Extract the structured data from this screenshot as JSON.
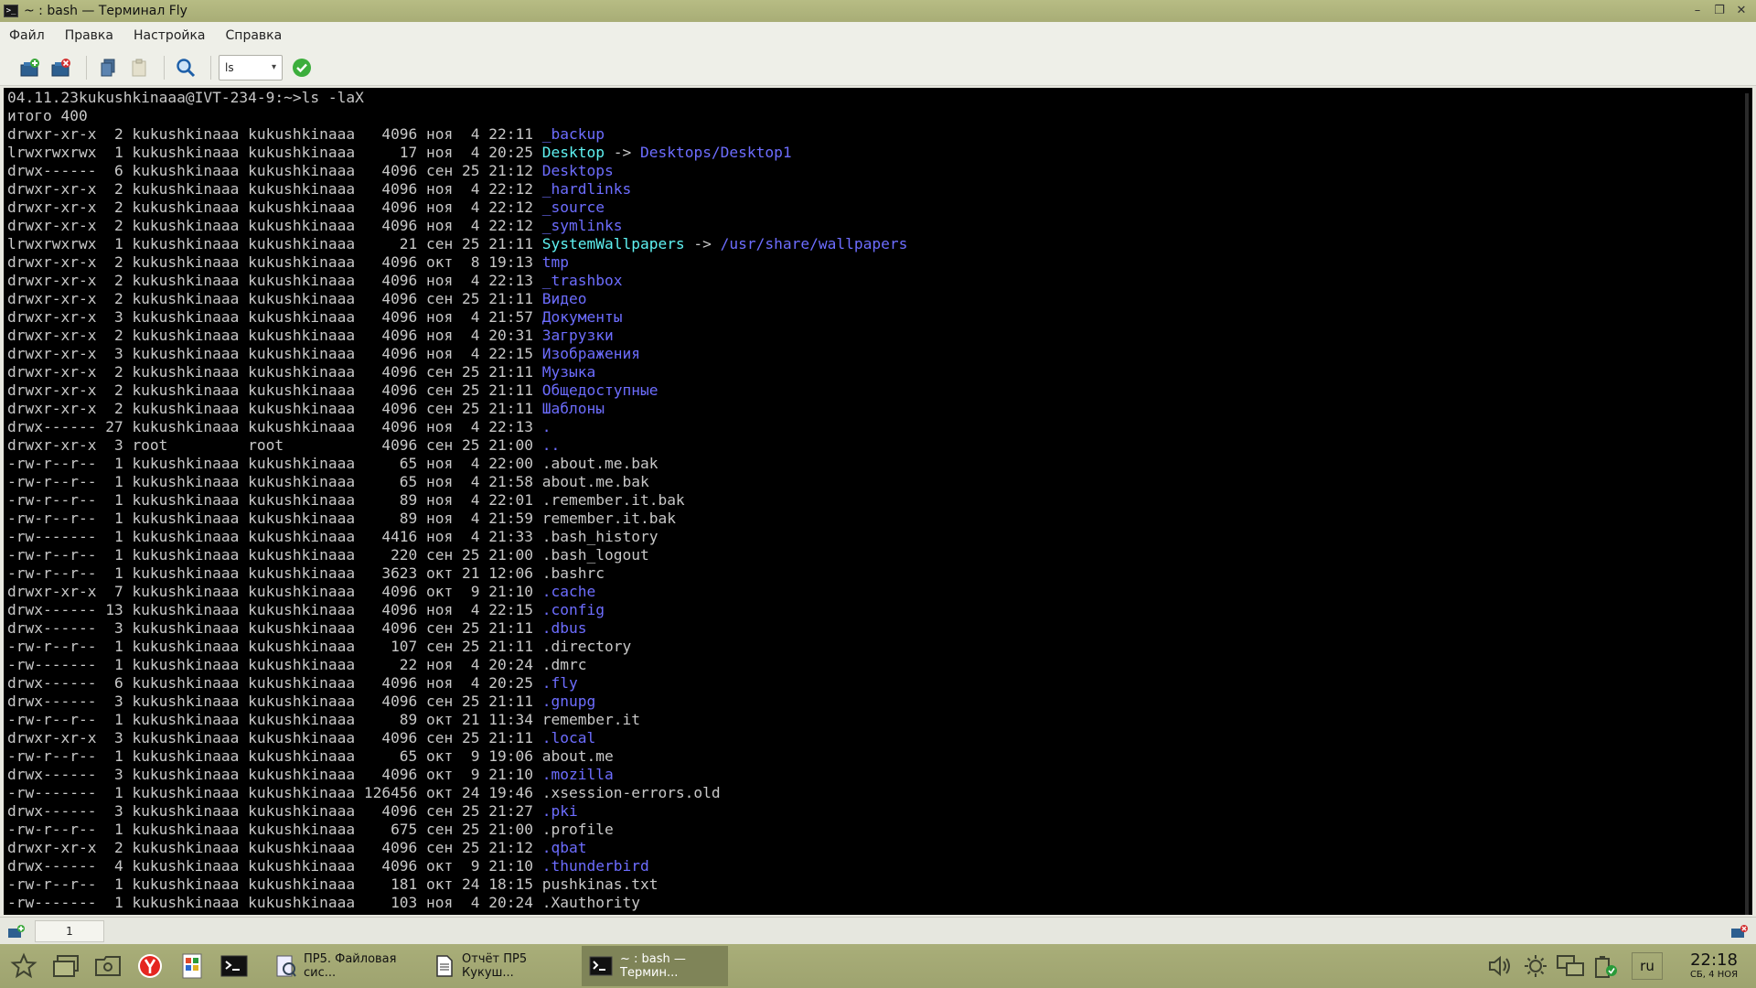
{
  "window": {
    "title": "~ : bash — Терминал Fly",
    "icon": "terminal-icon",
    "controls": [
      "minimize-icon",
      "restore-icon",
      "close-icon"
    ]
  },
  "menu": [
    "Файл",
    "Правка",
    "Настройка",
    "Справка"
  ],
  "toolbar": {
    "command_combo_value": "ls",
    "buttons": [
      "new-terminal-icon",
      "close-terminal-icon",
      "copy-icon",
      "paste-icon",
      "search-icon",
      "execute-icon"
    ]
  },
  "terminal": {
    "prompt": "04.11.23kukushkinaaa@IVT-234-9:~>",
    "command": "ls -laX",
    "total": "итого 400",
    "entries": [
      {
        "meta": "drwxr-xr-x  2 kukushkinaaa kukushkinaaa   4096 ноя  4 22:11 ",
        "name": "_backup",
        "type": "dir"
      },
      {
        "meta": "lrwxrwxrwx  1 kukushkinaaa kukushkinaaa     17 ноя  4 20:25 ",
        "name": "Desktop",
        "type": "link",
        "target": "Desktops/Desktop1"
      },
      {
        "meta": "drwx------  6 kukushkinaaa kukushkinaaa   4096 сен 25 21:12 ",
        "name": "Desktops",
        "type": "dir"
      },
      {
        "meta": "drwxr-xr-x  2 kukushkinaaa kukushkinaaa   4096 ноя  4 22:12 ",
        "name": "_hardlinks",
        "type": "dir"
      },
      {
        "meta": "drwxr-xr-x  2 kukushkinaaa kukushkinaaa   4096 ноя  4 22:12 ",
        "name": "_source",
        "type": "dir"
      },
      {
        "meta": "drwxr-xr-x  2 kukushkinaaa kukushkinaaa   4096 ноя  4 22:12 ",
        "name": "_symlinks",
        "type": "dir"
      },
      {
        "meta": "lrwxrwxrwx  1 kukushkinaaa kukushkinaaa     21 сен 25 21:11 ",
        "name": "SystemWallpapers",
        "type": "link",
        "target": "/usr/share/wallpapers"
      },
      {
        "meta": "drwxr-xr-x  2 kukushkinaaa kukushkinaaa   4096 окт  8 19:13 ",
        "name": "tmp",
        "type": "dir"
      },
      {
        "meta": "drwxr-xr-x  2 kukushkinaaa kukushkinaaa   4096 ноя  4 22:13 ",
        "name": "_trashbox",
        "type": "dir"
      },
      {
        "meta": "drwxr-xr-x  2 kukushkinaaa kukushkinaaa   4096 сен 25 21:11 ",
        "name": "Видео",
        "type": "dir"
      },
      {
        "meta": "drwxr-xr-x  3 kukushkinaaa kukushkinaaa   4096 ноя  4 21:57 ",
        "name": "Документы",
        "type": "dir"
      },
      {
        "meta": "drwxr-xr-x  2 kukushkinaaa kukushkinaaa   4096 ноя  4 20:31 ",
        "name": "Загрузки",
        "type": "dir"
      },
      {
        "meta": "drwxr-xr-x  3 kukushkinaaa kukushkinaaa   4096 ноя  4 22:15 ",
        "name": "Изображения",
        "type": "dir"
      },
      {
        "meta": "drwxr-xr-x  2 kukushkinaaa kukushkinaaa   4096 сен 25 21:11 ",
        "name": "Музыка",
        "type": "dir"
      },
      {
        "meta": "drwxr-xr-x  2 kukushkinaaa kukushkinaaa   4096 сен 25 21:11 ",
        "name": "Общедоступные",
        "type": "dir"
      },
      {
        "meta": "drwxr-xr-x  2 kukushkinaaa kukushkinaaa   4096 сен 25 21:11 ",
        "name": "Шаблоны",
        "type": "dir"
      },
      {
        "meta": "drwx------ 27 kukushkinaaa kukushkinaaa   4096 ноя  4 22:13 ",
        "name": ".",
        "type": "dir"
      },
      {
        "meta": "drwxr-xr-x  3 root         root           4096 сен 25 21:00 ",
        "name": "..",
        "type": "dir"
      },
      {
        "meta": "-rw-r--r--  1 kukushkinaaa kukushkinaaa     65 ноя  4 22:00 ",
        "name": ".about.me.bak",
        "type": "file"
      },
      {
        "meta": "-rw-r--r--  1 kukushkinaaa kukushkinaaa     65 ноя  4 21:58 ",
        "name": "about.me.bak",
        "type": "file"
      },
      {
        "meta": "-rw-r--r--  1 kukushkinaaa kukushkinaaa     89 ноя  4 22:01 ",
        "name": ".remember.it.bak",
        "type": "file"
      },
      {
        "meta": "-rw-r--r--  1 kukushkinaaa kukushkinaaa     89 ноя  4 21:59 ",
        "name": "remember.it.bak",
        "type": "file"
      },
      {
        "meta": "-rw-------  1 kukushkinaaa kukushkinaaa   4416 ноя  4 21:33 ",
        "name": ".bash_history",
        "type": "file"
      },
      {
        "meta": "-rw-r--r--  1 kukushkinaaa kukushkinaaa    220 сен 25 21:00 ",
        "name": ".bash_logout",
        "type": "file"
      },
      {
        "meta": "-rw-r--r--  1 kukushkinaaa kukushkinaaa   3623 окт 21 12:06 ",
        "name": ".bashrc",
        "type": "file"
      },
      {
        "meta": "drwxr-xr-x  7 kukushkinaaa kukushkinaaa   4096 окт  9 21:10 ",
        "name": ".cache",
        "type": "dir"
      },
      {
        "meta": "drwx------ 13 kukushkinaaa kukushkinaaa   4096 ноя  4 22:15 ",
        "name": ".config",
        "type": "dir"
      },
      {
        "meta": "drwx------  3 kukushkinaaa kukushkinaaa   4096 сен 25 21:11 ",
        "name": ".dbus",
        "type": "dir"
      },
      {
        "meta": "-rw-r--r--  1 kukushkinaaa kukushkinaaa    107 сен 25 21:11 ",
        "name": ".directory",
        "type": "file"
      },
      {
        "meta": "-rw-------  1 kukushkinaaa kukushkinaaa     22 ноя  4 20:24 ",
        "name": ".dmrc",
        "type": "file"
      },
      {
        "meta": "drwx------  6 kukushkinaaa kukushkinaaa   4096 ноя  4 20:25 ",
        "name": ".fly",
        "type": "dir"
      },
      {
        "meta": "drwx------  3 kukushkinaaa kukushkinaaa   4096 сен 25 21:11 ",
        "name": ".gnupg",
        "type": "dir"
      },
      {
        "meta": "-rw-r--r--  1 kukushkinaaa kukushkinaaa     89 окт 21 11:34 ",
        "name": "remember.it",
        "type": "file"
      },
      {
        "meta": "drwxr-xr-x  3 kukushkinaaa kukushkinaaa   4096 сен 25 21:11 ",
        "name": ".local",
        "type": "dir"
      },
      {
        "meta": "-rw-r--r--  1 kukushkinaaa kukushkinaaa     65 окт  9 19:06 ",
        "name": "about.me",
        "type": "file"
      },
      {
        "meta": "drwx------  3 kukushkinaaa kukushkinaaa   4096 окт  9 21:10 ",
        "name": ".mozilla",
        "type": "dir"
      },
      {
        "meta": "-rw-------  1 kukushkinaaa kukushkinaaa 126456 окт 24 19:46 ",
        "name": ".xsession-errors.old",
        "type": "file"
      },
      {
        "meta": "drwx------  3 kukushkinaaa kukushkinaaa   4096 сен 25 21:27 ",
        "name": ".pki",
        "type": "dir"
      },
      {
        "meta": "-rw-r--r--  1 kukushkinaaa kukushkinaaa    675 сен 25 21:00 ",
        "name": ".profile",
        "type": "file"
      },
      {
        "meta": "drwxr-xr-x  2 kukushkinaaa kukushkinaaa   4096 сен 25 21:12 ",
        "name": ".qbat",
        "type": "dir"
      },
      {
        "meta": "drwx------  4 kukushkinaaa kukushkinaaa   4096 окт  9 21:10 ",
        "name": ".thunderbird",
        "type": "dir"
      },
      {
        "meta": "-rw-r--r--  1 kukushkinaaa kukushkinaaa    181 окт 24 18:15 ",
        "name": "pushkinas.txt",
        "type": "file"
      },
      {
        "meta": "-rw-------  1 kukushkinaaa kukushkinaaa    103 ноя  4 20:24 ",
        "name": ".Xauthority",
        "type": "file"
      }
    ]
  },
  "tabs": {
    "items": [
      "1"
    ]
  },
  "taskbar": {
    "launchers": [
      "start-menu-icon",
      "desktops-icon",
      "file-manager-icon",
      "yandex-browser-icon",
      "office-icon",
      "terminal-launcher-icon"
    ],
    "tasks": [
      {
        "label": "ПР5. Файловая сис...",
        "icon": "document-viewer-icon",
        "active": false
      },
      {
        "label": "Отчёт ПР5 Кукуш...",
        "icon": "document-icon",
        "active": false
      },
      {
        "label": "~ : bash — Термин...",
        "icon": "terminal-icon",
        "active": true
      }
    ],
    "tray": [
      "volume-icon",
      "brightness-icon",
      "network-icon",
      "battery-icon"
    ],
    "lang": "ru",
    "time": "22:18",
    "date": "СБ, 4 НОЯ"
  },
  "colors": {
    "dir": "#6d6dff",
    "link": "#5ff3f3",
    "text": "#c8c8c8",
    "panel": "#a8ad76"
  }
}
